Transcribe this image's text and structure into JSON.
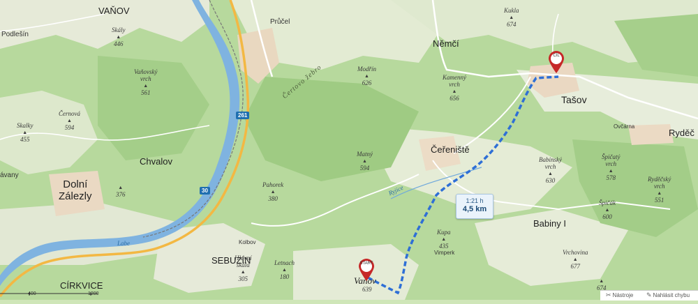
{
  "places": {
    "vanov": "VAŇOV",
    "podlesin": "Podlešín",
    "prosec_top": "Průčel",
    "nemci": "Němčí",
    "tasov": "Tašov",
    "cerenistе": "Čeřeniště",
    "chvalov": "Chvalov",
    "dolni_zalezly": "Dolní\nZálezly",
    "dolni_zalezly_line1": "Dolní",
    "dolni_zalezly_line2": "Zálezly",
    "rydec": "Ryděč",
    "ovcarna": "Ovčárna",
    "babiny": "Babiny I",
    "sebuzin": "SEBUZÍN",
    "cirkvice": "CÍRKVICE",
    "vanov_bottom": "Vaňov",
    "kolbov": "Kolbov",
    "vimperk": "Vimperk",
    "avany": "ávany"
  },
  "peaks": [
    {
      "name": "Skály",
      "elev": "446"
    },
    {
      "name": "Vaňovský\nvrch",
      "elev": "561"
    },
    {
      "name": "Černová",
      "elev": "594"
    },
    {
      "name": "Skalky",
      "elev": "455"
    },
    {
      "name": "Modřín",
      "elev": "626"
    },
    {
      "name": "Kamenný\nvrch",
      "elev": "656"
    },
    {
      "name": "Kukla",
      "elev": "674"
    },
    {
      "name": "Matný",
      "elev": "594"
    },
    {
      "name": "Babinský\nvrch",
      "elev": "630"
    },
    {
      "name": "Špičatý\nvrch",
      "elev": "578"
    },
    {
      "name": "Ryděčský\nvrch",
      "elev": "551"
    },
    {
      "name": "Špičák",
      "elev": "600"
    },
    {
      "name": "Vrchovina",
      "elev": "677"
    },
    {
      "name": "Pahorek",
      "elev": "380"
    },
    {
      "name": "Kupa",
      "elev": "435"
    },
    {
      "name": "Hlavní\nskála",
      "elev": "305"
    },
    {
      "name": "Letnach",
      "elev": "180"
    },
    {
      "name": "",
      "elev": "376"
    },
    {
      "name": "",
      "elev": "674"
    },
    {
      "name": "",
      "elev": "639"
    }
  ],
  "roads": {
    "r261": "261",
    "r30": "30"
  },
  "water": {
    "river_name": "Labe",
    "stream_name": "Ryjice"
  },
  "ridge": "Čertovo žebro",
  "route": {
    "time": "1:21 h",
    "distance": "4,5 km",
    "start_label": "START",
    "end_label": "CÍL",
    "route_color": "#2e6fd6"
  },
  "toolbar": {
    "tools_label": "Nástroje",
    "report_label": "Nahlásit chybu",
    "tools_icon": "scissors-icon",
    "report_icon": "pencil-icon"
  },
  "scale": {
    "v1": "400",
    "v2": "1200"
  },
  "colors": {
    "forest": "#a8d08d",
    "meadow": "#e9eddc",
    "river": "#6fa8dc",
    "highway": "#f2b84b"
  }
}
